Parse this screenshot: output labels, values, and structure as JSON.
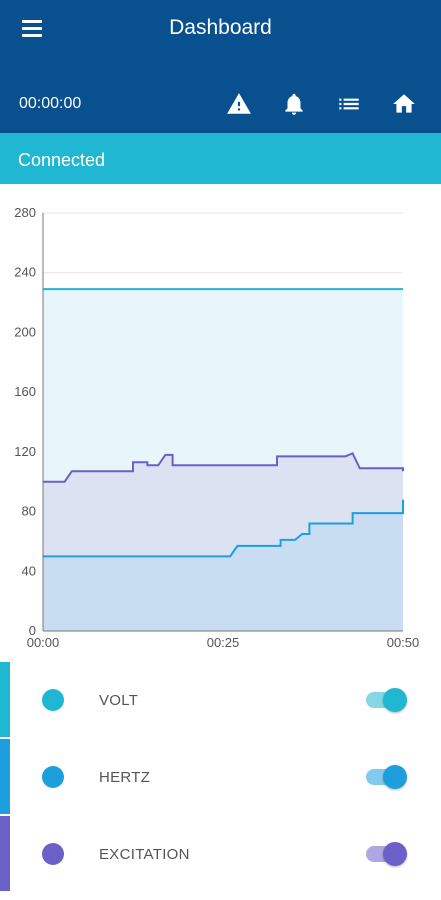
{
  "appbar": {
    "title": "Dashboard",
    "timer": "00:00:00",
    "menu_icon": "menu-icon",
    "actions": [
      "warning-icon",
      "bell-icon",
      "list-icon",
      "home-icon"
    ]
  },
  "status": {
    "text": "Connected"
  },
  "chart_data": {
    "type": "area",
    "title": "",
    "xlabel": "",
    "ylabel": "",
    "x_ticks": [
      "00:00",
      "00:25",
      "00:50"
    ],
    "xlim": [
      0,
      50
    ],
    "ylim": [
      0,
      280
    ],
    "y_ticks": [
      0,
      40,
      80,
      120,
      160,
      200,
      240,
      280
    ],
    "grid": true,
    "series": [
      {
        "name": "VOLT",
        "color": "#20b7d2",
        "x": [
          0,
          50
        ],
        "y": [
          229,
          229
        ]
      },
      {
        "name": "EXCITATION",
        "color": "#6b5fc8",
        "x": [
          0,
          3,
          4,
          12.5,
          12.5,
          14.5,
          14.5,
          16,
          17,
          18,
          18,
          32.5,
          32.5,
          42,
          43,
          44,
          50,
          50
        ],
        "y": [
          100,
          100,
          107,
          107,
          113,
          113,
          111,
          111,
          118,
          118,
          111,
          111,
          117,
          117,
          119,
          109,
          109,
          107
        ]
      },
      {
        "name": "HERTZ",
        "color": "#1e9fdd",
        "x": [
          0,
          26,
          27,
          33,
          33,
          35,
          36,
          36,
          37,
          37,
          43,
          43,
          50,
          50
        ],
        "y": [
          50,
          50,
          57,
          57,
          61,
          61,
          65,
          65,
          65,
          72,
          72,
          79,
          79,
          88
        ]
      }
    ]
  },
  "legend": [
    {
      "label": "VOLT",
      "color": "#20b7d2",
      "enabled": true
    },
    {
      "label": "HERTZ",
      "color": "#1e9fdd",
      "enabled": true
    },
    {
      "label": "EXCITATION",
      "color": "#6b5fc8",
      "enabled": true
    }
  ]
}
